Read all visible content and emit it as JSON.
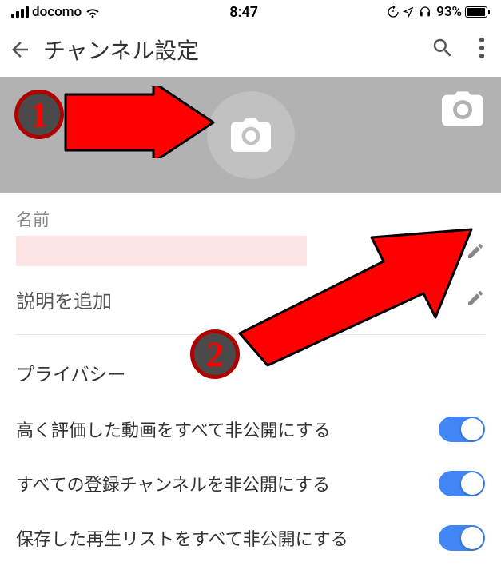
{
  "status": {
    "carrier": "docomo",
    "time": "8:47",
    "battery_pct": "93%"
  },
  "appbar": {
    "title": "チャンネル設定"
  },
  "fields": {
    "name_label": "名前",
    "name_value": "",
    "description_placeholder": "説明を追加"
  },
  "privacy": {
    "header": "プライバシー",
    "rows": [
      {
        "label": "高く評価した動画をすべて非公開にする",
        "on": true
      },
      {
        "label": "すべての登録チャンネルを非公開にする",
        "on": true
      },
      {
        "label": "保存した再生リストをすべて非公開にする",
        "on": true
      }
    ]
  },
  "annotations": {
    "badge1": "1",
    "badge2": "2"
  },
  "colors": {
    "accent": "#4285f4",
    "arrow": "#ff0000",
    "banner": "#b3b2b3"
  }
}
